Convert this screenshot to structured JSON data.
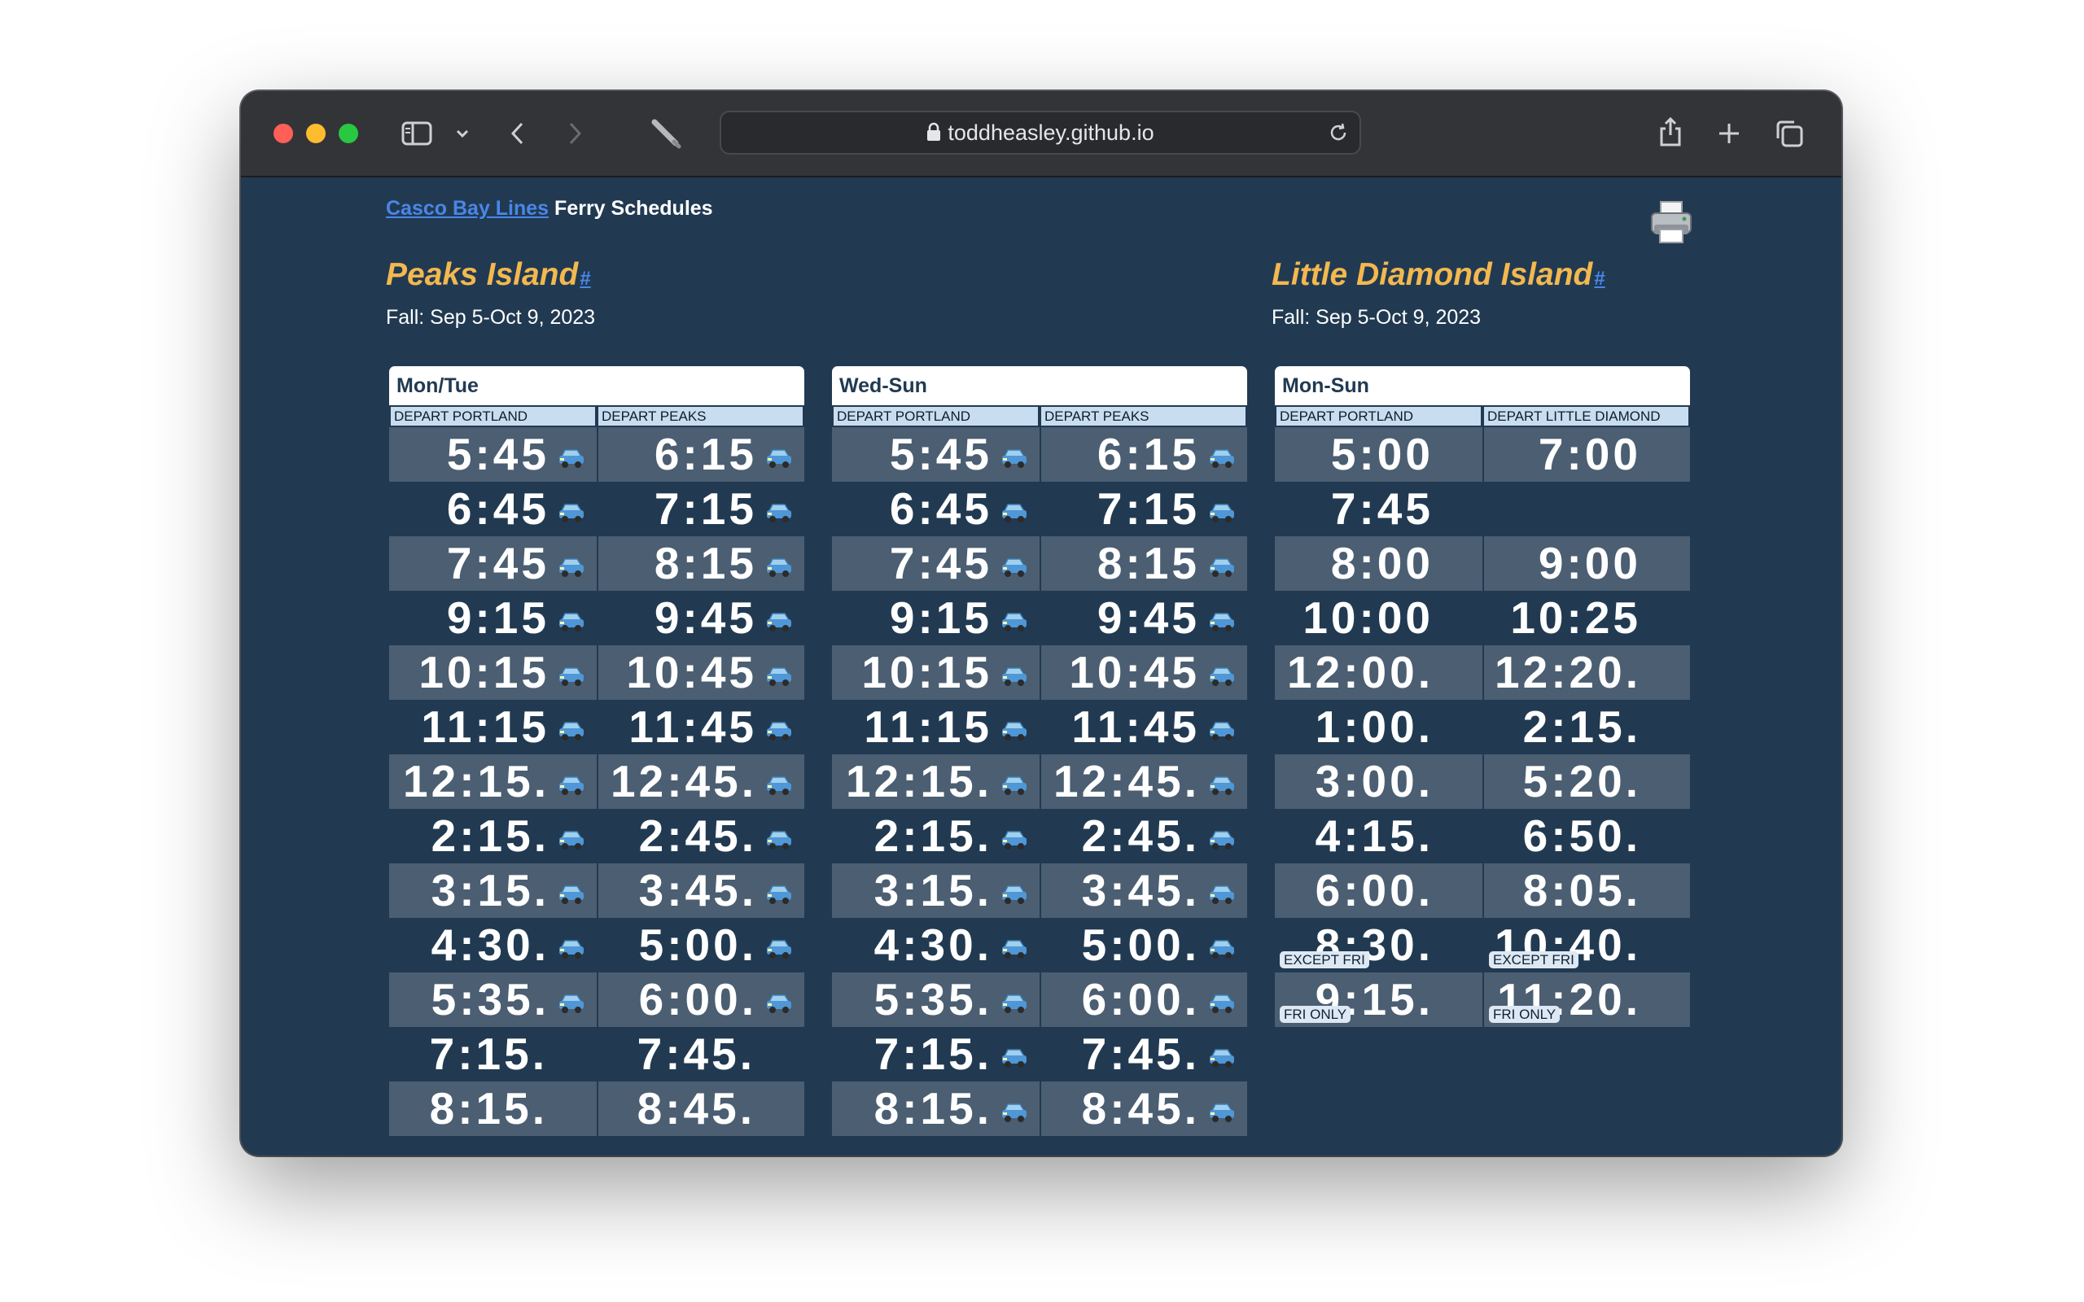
{
  "browser": {
    "url": "toddheasley.github.io",
    "icons": {
      "sidebar": "sidebar-icon",
      "chevron": "chevron-down-icon",
      "back": "back-arrow-icon",
      "forward": "forward-arrow-icon",
      "extension": "pen-icon",
      "lock": "lock-icon",
      "reload": "reload-icon",
      "share": "share-icon",
      "new_tab": "plus-icon",
      "tabs": "tabs-overview-icon"
    }
  },
  "header": {
    "link_text": "Casco Bay Lines",
    "title_text": "Ferry Schedules",
    "print_icon": "printer-icon"
  },
  "peaks": {
    "title": "Peaks Island",
    "anchor": "#",
    "season": "Fall: Sep 5-Oct 9, 2023",
    "tables": [
      {
        "day": "Mon/Tue",
        "col1": "DEPART PORTLAND",
        "col2": "DEPART PEAKS",
        "rows": [
          {
            "a": "5:45",
            "a_car": true,
            "b": "6:15",
            "b_car": true
          },
          {
            "a": "6:45",
            "a_car": true,
            "b": "7:15",
            "b_car": true
          },
          {
            "a": "7:45",
            "a_car": true,
            "b": "8:15",
            "b_car": true
          },
          {
            "a": "9:15",
            "a_car": true,
            "b": "9:45",
            "b_car": true
          },
          {
            "a": "10:15",
            "a_car": true,
            "b": "10:45",
            "b_car": true
          },
          {
            "a": "11:15",
            "a_car": true,
            "b": "11:45",
            "b_car": true
          },
          {
            "a": "12:15.",
            "a_car": true,
            "b": "12:45.",
            "b_car": true
          },
          {
            "a": "2:15.",
            "a_car": true,
            "b": "2:45.",
            "b_car": true
          },
          {
            "a": "3:15.",
            "a_car": true,
            "b": "3:45.",
            "b_car": true
          },
          {
            "a": "4:30.",
            "a_car": true,
            "b": "5:00.",
            "b_car": true
          },
          {
            "a": "5:35.",
            "a_car": true,
            "b": "6:00.",
            "b_car": true
          },
          {
            "a": "7:15.",
            "a_car": false,
            "b": "7:45.",
            "b_car": false
          },
          {
            "a": "8:15.",
            "a_car": false,
            "b": "8:45.",
            "b_car": false
          }
        ]
      },
      {
        "day": "Wed-Sun",
        "col1": "DEPART PORTLAND",
        "col2": "DEPART PEAKS",
        "rows": [
          {
            "a": "5:45",
            "a_car": true,
            "b": "6:15",
            "b_car": true
          },
          {
            "a": "6:45",
            "a_car": true,
            "b": "7:15",
            "b_car": true
          },
          {
            "a": "7:45",
            "a_car": true,
            "b": "8:15",
            "b_car": true
          },
          {
            "a": "9:15",
            "a_car": true,
            "b": "9:45",
            "b_car": true
          },
          {
            "a": "10:15",
            "a_car": true,
            "b": "10:45",
            "b_car": true
          },
          {
            "a": "11:15",
            "a_car": true,
            "b": "11:45",
            "b_car": true
          },
          {
            "a": "12:15.",
            "a_car": true,
            "b": "12:45.",
            "b_car": true
          },
          {
            "a": "2:15.",
            "a_car": true,
            "b": "2:45.",
            "b_car": true
          },
          {
            "a": "3:15.",
            "a_car": true,
            "b": "3:45.",
            "b_car": true
          },
          {
            "a": "4:30.",
            "a_car": true,
            "b": "5:00.",
            "b_car": true
          },
          {
            "a": "5:35.",
            "a_car": true,
            "b": "6:00.",
            "b_car": true
          },
          {
            "a": "7:15.",
            "a_car": true,
            "b": "7:45.",
            "b_car": true
          },
          {
            "a": "8:15.",
            "a_car": true,
            "b": "8:45.",
            "b_car": true
          }
        ]
      }
    ]
  },
  "little_diamond": {
    "title": "Little Diamond Island",
    "anchor": "#",
    "season": "Fall: Sep 5-Oct 9, 2023",
    "tables": [
      {
        "day": "Mon-Sun",
        "col1": "DEPART PORTLAND",
        "col2": "DEPART LITTLE DIAMOND",
        "rows": [
          {
            "a": "5:00",
            "a_car": false,
            "b": "7:00",
            "b_car": false
          },
          {
            "a": "7:45",
            "a_car": false,
            "b": "",
            "b_car": false
          },
          {
            "a": "8:00",
            "a_car": false,
            "b": "9:00",
            "b_car": false
          },
          {
            "a": "10:00",
            "a_car": false,
            "b": "10:25",
            "b_car": false
          },
          {
            "a": "12:00.",
            "a_car": false,
            "b": "12:20.",
            "b_car": false
          },
          {
            "a": "1:00.",
            "a_car": false,
            "b": "2:15.",
            "b_car": false
          },
          {
            "a": "3:00.",
            "a_car": false,
            "b": "5:20.",
            "b_car": false
          },
          {
            "a": "4:15.",
            "a_car": false,
            "b": "6:50.",
            "b_car": false
          },
          {
            "a": "6:00.",
            "a_car": false,
            "b": "8:05.",
            "b_car": false
          },
          {
            "a": "8:30.",
            "a_car": false,
            "a_badge": "EXCEPT FRI",
            "b": "10:40.",
            "b_car": false,
            "b_badge": "EXCEPT FRI"
          },
          {
            "a": "9:15.",
            "a_car": false,
            "a_badge": "FRI ONLY",
            "b": "11:20.",
            "b_car": false,
            "b_badge": "FRI ONLY"
          }
        ]
      }
    ]
  },
  "colors": {
    "page_bg": "#213a52",
    "title_accent": "#f3b84f",
    "link": "#4a86e8",
    "row_shade": "#4b5e72"
  }
}
